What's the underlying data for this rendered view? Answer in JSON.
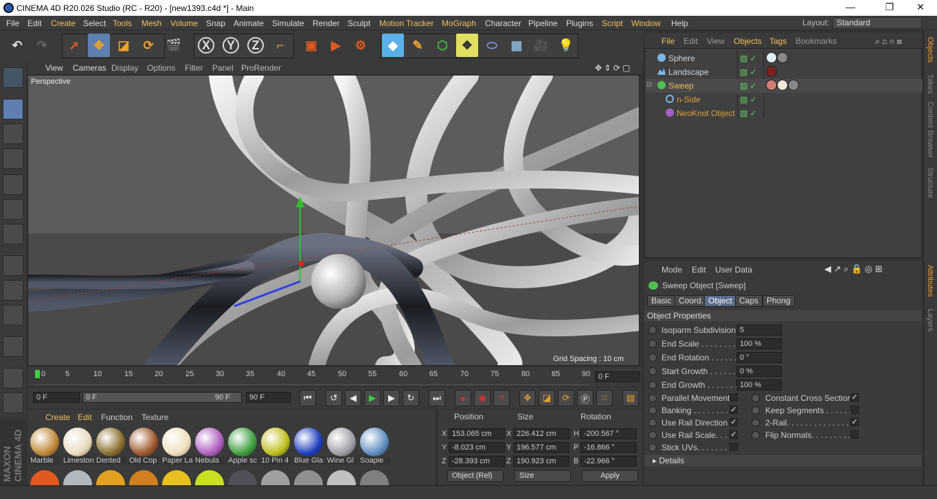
{
  "window": {
    "title": "CINEMA 4D R20.026 Studio (RC - R20) - [new1393.c4d *] - Main",
    "controls": [
      "—",
      "❐",
      "✕"
    ]
  },
  "menubar": {
    "items": [
      "File",
      "Edit",
      "Create",
      "Select",
      "Tools",
      "Mesh",
      "Volume",
      "Snap",
      "Animate",
      "Simulate",
      "Render",
      "Sculpt",
      "Motion Tracker",
      "MoGraph",
      "Character",
      "Pipeline",
      "Plugins",
      "Script",
      "Window",
      "Help"
    ],
    "layout_label": "Layout:",
    "layout_value": "Standard"
  },
  "toolbar": {
    "axes": [
      "X",
      "Y",
      "Z"
    ]
  },
  "viewport": {
    "menu": [
      "View",
      "Cameras",
      "Display",
      "Options",
      "Filter",
      "Panel",
      "ProRender"
    ],
    "label": "Perspective",
    "grid_spacing": "Grid Spacing : 10 cm"
  },
  "timeline": {
    "ticks": [
      "0",
      "5",
      "10",
      "15",
      "20",
      "25",
      "30",
      "35",
      "40",
      "45",
      "50",
      "55",
      "60",
      "65",
      "70",
      "75",
      "80",
      "85",
      "90"
    ],
    "current_frame": "0 F",
    "start": "0 F",
    "range_start": "0 F",
    "range_end": "90 F",
    "end": "90 F"
  },
  "materials": {
    "menu": [
      "Create",
      "Edit",
      "Function",
      "Texture"
    ],
    "items": [
      {
        "name": "Marble",
        "color": "#c08a3a"
      },
      {
        "name": "Limestone",
        "color": "#e8dcc0"
      },
      {
        "name": "Dented",
        "color": "#8a7030"
      },
      {
        "name": "Old Cop",
        "color": "#a05a30"
      },
      {
        "name": "Paper La",
        "color": "#f0e0c0"
      },
      {
        "name": "Nebula",
        "color": "#b060c0"
      },
      {
        "name": "Apple sc",
        "color": "#40a040"
      },
      {
        "name": "10 Pin 4",
        "color": "#c0c020"
      },
      {
        "name": "Blue Gla",
        "color": "#2040c0"
      },
      {
        "name": "Wine Gl",
        "color": "#a0a0a8"
      },
      {
        "name": "Soapie",
        "color": "#6090c0"
      }
    ],
    "row2_colors": [
      "#e05a20",
      "#b0b8c0",
      "#e0a020",
      "#d08020",
      "#e8c020",
      "#c8e020",
      "#505058",
      "#a0a0a0",
      "#909090",
      "#c0c0c0",
      "#808080"
    ]
  },
  "coordinates": {
    "headers": {
      "position": "Position",
      "size": "Size",
      "rotation": "Rotation"
    },
    "rows": [
      {
        "axis": "X",
        "pos": "153.065 cm",
        "size_axis": "X",
        "size": "226.412 cm",
        "rot_axis": "H",
        "rot": "-200.567 °"
      },
      {
        "axis": "Y",
        "pos": "-8.023 cm",
        "size_axis": "Y",
        "size": "196.577 cm",
        "rot_axis": "P",
        "rot": "-16.866 °"
      },
      {
        "axis": "Z",
        "pos": "-28.393 cm",
        "size_axis": "Z",
        "size": "190.923 cm",
        "rot_axis": "B",
        "rot": "-22.966 °"
      }
    ],
    "mode": "Object (Rel)",
    "size_mode": "Size",
    "apply": "Apply"
  },
  "object_manager": {
    "menu": [
      "File",
      "Edit",
      "View",
      "Objects",
      "Tags",
      "Bookmarks"
    ],
    "objects": [
      {
        "name": "Sphere",
        "indent": 0,
        "color": "#cfd8e0"
      },
      {
        "name": "Landscape",
        "indent": 0,
        "color": "#cfd8e0"
      },
      {
        "name": "Sweep",
        "indent": 0,
        "color": "#f0c060"
      },
      {
        "name": "n-Side",
        "indent": 1,
        "color": "#e0a040"
      },
      {
        "name": "NeoKnot Object",
        "indent": 1,
        "color": "#e0a040"
      }
    ]
  },
  "attributes": {
    "menu": [
      "Mode",
      "Edit",
      "User Data"
    ],
    "title": "Sweep Object [Sweep]",
    "tabs": [
      "Basic",
      "Coord.",
      "Object",
      "Caps",
      "Phong"
    ],
    "active_tab": "Object",
    "section": "Object Properties",
    "props": [
      {
        "label": "Isoparm Subdivision",
        "value": "5"
      },
      {
        "label": "End Scale . . . . . . . . . .",
        "value": "100 %"
      },
      {
        "label": "End Rotation . . . . . . .",
        "value": "0 °"
      },
      {
        "label": "Start Growth . . . . . . .",
        "value": "0 %"
      },
      {
        "label": "End Growth . . . . . . . .",
        "value": "100 %"
      }
    ],
    "checks_left": [
      {
        "label": "Parallel Movement",
        "checked": false
      },
      {
        "label": "Banking . . . . . . . . .",
        "checked": true
      },
      {
        "label": "Use Rail Direction",
        "checked": true
      },
      {
        "label": "Use Rail Scale. . . .",
        "checked": true
      },
      {
        "label": "Stick UVs. . . . . . . .",
        "checked": false
      }
    ],
    "checks_right": [
      {
        "label": "Constant Cross Section",
        "checked": true
      },
      {
        "label": "Keep Segments . . . . . . .",
        "checked": false
      },
      {
        "label": "2-Rail. . . . . . . . . . . . . . . .",
        "checked": true
      },
      {
        "label": "Flip Normals. . . . . . . . .",
        "checked": false
      }
    ],
    "details": "Details"
  },
  "right_tabs": [
    "Objects",
    "Takes",
    "Content Browser",
    "Structure",
    "Attributes",
    "Layers"
  ],
  "branding": "MAXON CINEMA 4D"
}
